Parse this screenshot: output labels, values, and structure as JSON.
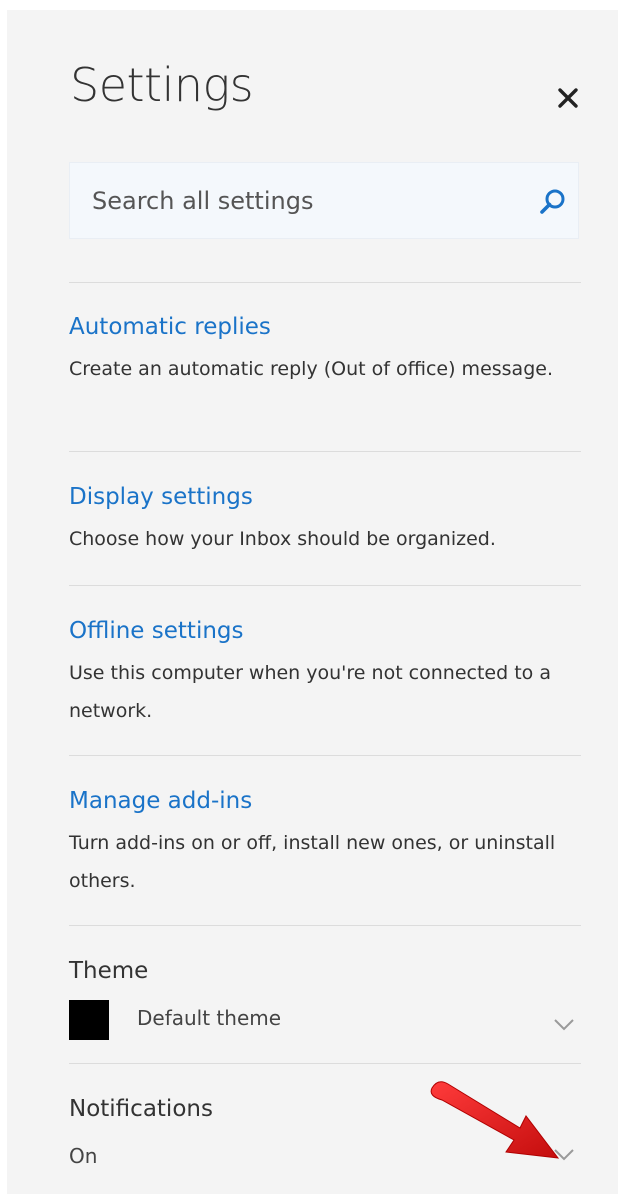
{
  "header": {
    "title": "Settings",
    "close_icon": "close-icon"
  },
  "search": {
    "placeholder": "Search all settings",
    "value": "",
    "icon": "search-icon"
  },
  "settings": [
    {
      "label": "Automatic replies",
      "description": "Create an automatic reply (Out of office) message."
    },
    {
      "label": "Display settings",
      "description": "Choose how your Inbox should be organized."
    },
    {
      "label": "Offline settings",
      "description": "Use this computer when you're not connected to a network."
    },
    {
      "label": "Manage add-ins",
      "description": "Turn add-ins on or off, install new ones, or uninstall others."
    }
  ],
  "theme": {
    "label": "Theme",
    "value": "Default theme",
    "swatch_color": "#000000"
  },
  "notifications": {
    "label": "Notifications",
    "value": "On"
  },
  "colors": {
    "link": "#1a73c8",
    "panel_bg": "#f4f4f4",
    "arrow": "#e01b1b"
  }
}
